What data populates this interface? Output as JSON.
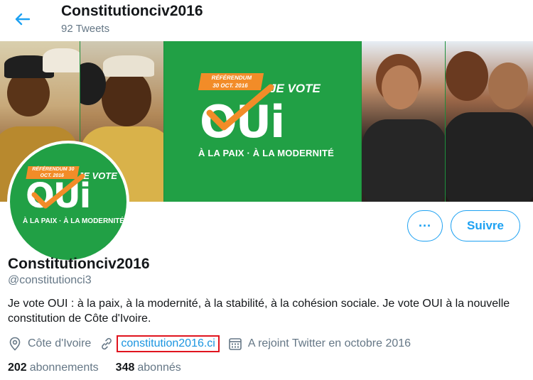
{
  "header": {
    "back_icon": "arrow-left-icon",
    "name": "Constitutionciv2016",
    "tweet_count": "92 Tweets"
  },
  "banner": {
    "referendum_line1": "RÉFÉRENDUM",
    "referendum_line2": "30 OCT. 2016",
    "je_vote": "JE VOTE",
    "oui": "OUi",
    "tagline": "À LA PAIX · À LA MODERNITÉ"
  },
  "avatar": {
    "referendum": "RÉFÉRENDUM 30 OCT. 2016",
    "je_vote": "JE VOTE",
    "oui": "OUi",
    "tagline": "À LA PAIX · À LA MODERNITÉ"
  },
  "actions": {
    "more_label": "···",
    "follow_label": "Suivre"
  },
  "profile": {
    "display_name": "Constitutionciv2016",
    "handle": "@constitutionci3",
    "bio": "Je vote OUI :  à la paix, à la modernité, à la stabilité, à la cohésion sociale. Je vote OUI à la nouvelle constitution de Côte d'Ivoire.",
    "location": "Côte d'Ivoire",
    "website": "constitution2016.ci",
    "joined": "A rejoint Twitter en octobre 2016"
  },
  "stats": {
    "following_count": "202",
    "following_label": "abonnements",
    "followers_count": "348",
    "followers_label": "abonnés"
  },
  "colors": {
    "accent": "#1da1f2",
    "brand_green": "#21a045",
    "brand_orange": "#f28c28",
    "highlight_red": "#e0141e"
  }
}
